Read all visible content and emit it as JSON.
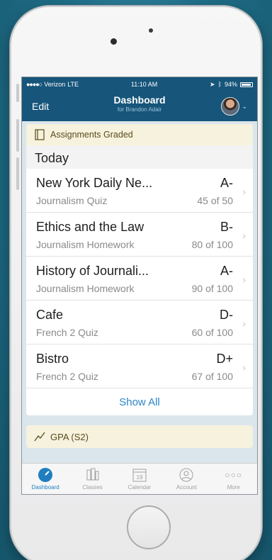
{
  "status_bar": {
    "carrier": "Verizon",
    "network": "LTE",
    "time": "11:10 AM",
    "battery": "94%"
  },
  "nav": {
    "edit_label": "Edit",
    "title": "Dashboard",
    "subtitle": "for Brandon Adair"
  },
  "assignments": {
    "header": "Assignments Graded",
    "section": "Today",
    "rows": [
      {
        "title": "New York Daily Ne...",
        "grade": "A-",
        "category": "Journalism Quiz",
        "score": "45 of 50"
      },
      {
        "title": "Ethics and the Law",
        "grade": "B-",
        "category": "Journalism Homework",
        "score": "80 of 100"
      },
      {
        "title": "History of Journali...",
        "grade": "A-",
        "category": "Journalism Homework",
        "score": "90 of 100"
      },
      {
        "title": "Cafe",
        "grade": "D-",
        "category": "French 2 Quiz",
        "score": "60 of 100"
      },
      {
        "title": "Bistro",
        "grade": "D+",
        "category": "French 2 Quiz",
        "score": "67 of 100"
      }
    ],
    "show_all": "Show All"
  },
  "gpa": {
    "header": "GPA (S2)"
  },
  "tabs": [
    {
      "label": "Dashboard",
      "icon": "dashboard-icon",
      "active": true
    },
    {
      "label": "Classes",
      "icon": "classes-icon",
      "active": false
    },
    {
      "label": "Calendar",
      "icon": "calendar-icon",
      "calendar_day": "19",
      "active": false
    },
    {
      "label": "Account",
      "icon": "account-icon",
      "active": false
    },
    {
      "label": "More",
      "icon": "more-icon",
      "active": false
    }
  ],
  "colors": {
    "nav_bg": "#17557a",
    "accent": "#2a86c6",
    "card_header_bg": "#f6f2dd",
    "active_tab": "#1f7ec0"
  }
}
